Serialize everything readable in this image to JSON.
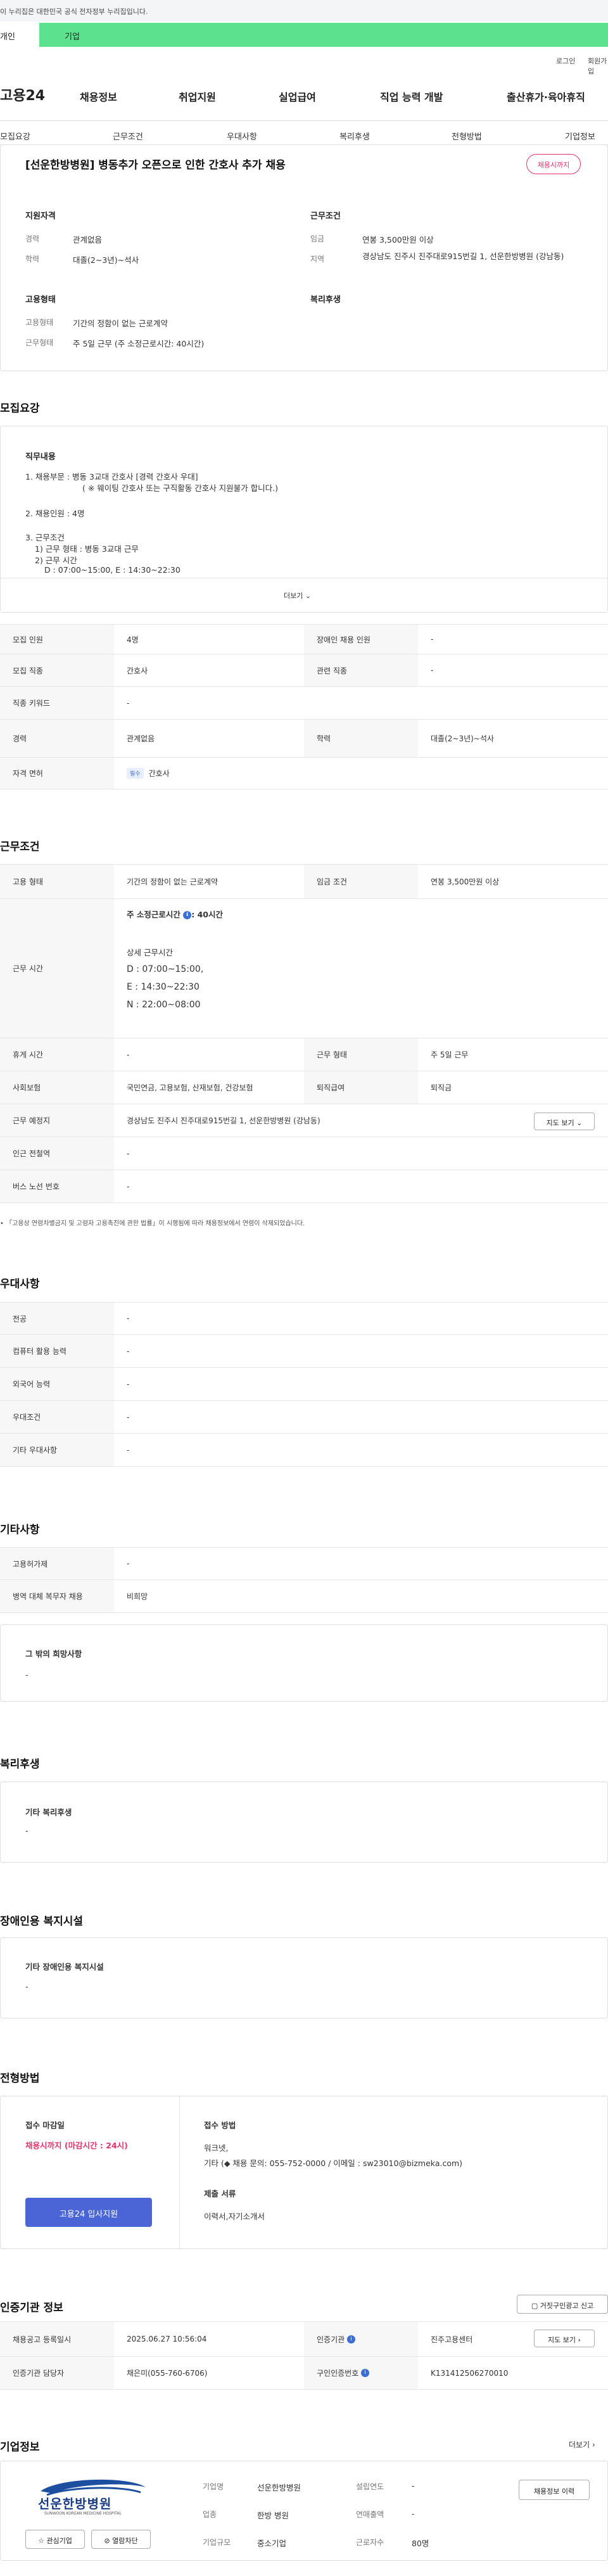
{
  "gov_banner": "이 누리집은 대한민국 공식 전자정부 누리집입니다.",
  "top_tabs": {
    "personal": "개인",
    "company": "기업"
  },
  "util": {
    "login": "로그인",
    "signup": "회원가입"
  },
  "logo": "고용24",
  "main_nav": [
    "채용정보",
    "취업지원",
    "실업급여",
    "직업 능력 개발",
    "출산휴가·육아휴직"
  ],
  "sub_nav": [
    "모집요강",
    "근무조건",
    "우대사항",
    "복리후생",
    "전형방법",
    "기업정보"
  ],
  "summary": {
    "title": "[선운한방병원] 병동추가 오픈으로 인한 간호사 추가 채용",
    "badge": "채용시까지",
    "qual_title": "지원자격",
    "career_lbl": "경력",
    "career": "관계없음",
    "edu_lbl": "학력",
    "edu": "대졸(2~3년)~석사",
    "cond_title": "근무조건",
    "wage_lbl": "임금",
    "wage": "연봉 3,500만원 이상",
    "area_lbl": "지역",
    "area": "경상남도 진주시 진주대로915번길 1, 선운한방병원 (강남동)",
    "emp_title": "고용형태",
    "emptype_lbl": "고용형태",
    "emptype": "기간의 정함이 없는 근로계약",
    "worktype_lbl": "근무형태",
    "worktype": "주 5일 근무 (주 소정근로시간: 40시간)",
    "welfare_title": "복리후생"
  },
  "recruit": {
    "section": "모집요강",
    "job_title": "직무내용",
    "lines": [
      "1. 채용부문 :  병동 3교대 간호사 [경력 간호사 우대]",
      "( ※ 웨이팅 간호사 또는 구직활동 간호사 지원불가 합니다.)",
      "2. 채용인원 :  4명",
      "3.  근무조건",
      "1) 근무 형태 :  병동 3교대 근무",
      "2) 근무 시간",
      "D : 07:00~15:00, E : 14:30~22:30"
    ],
    "more": "더보기",
    "rows": [
      {
        "l1": "모집 인원",
        "v1": "4명",
        "l2": "장애인 채용 인원",
        "v2": "-"
      },
      {
        "l1": "모집 직종",
        "v1": "간호사",
        "l2": "관련 직종",
        "v2": "-"
      },
      {
        "l1": "직종 키워드",
        "v1": "-"
      },
      {
        "l1": "경력",
        "v1": "관계없음",
        "l2": "학력",
        "v2": "대졸(2~3년)~석사"
      },
      {
        "l1": "자격 면허",
        "tag": "필수",
        "v1": "간호사"
      }
    ]
  },
  "conditions": {
    "section": "근무조건",
    "emptype_lbl": "고용 형태",
    "emptype": "기간의 정함이 없는 근로계약",
    "wage_lbl": "임금 조건",
    "wage": "연봉 3,500만원 이상",
    "hours_lbl": "근무 시간",
    "hours_title": "주 소정근로시간",
    "hours": ": 40시간",
    "detail_title": "상세 근무시간",
    "d": "D : 07:00~15:00,",
    "e": "E : 14:30~22:30",
    "n": "N : 22:00~08:00",
    "break_lbl": "휴게 시간",
    "break": "-",
    "form_lbl": "근무 형태",
    "form": "주 5일 근무",
    "ins_lbl": "사회보험",
    "ins": "국민연금, 고용보험, 산재보험, 건강보험",
    "ret_lbl": "퇴직급여",
    "ret": "퇴직금",
    "loc_lbl": "근무 예정지",
    "loc": "경상남도 진주시 진주대로915번길 1, 선운한방병원 (강남동)",
    "map_btn": "지도 보기",
    "station_lbl": "인근 전철역",
    "station": "-",
    "bus_lbl": "버스 노선 번호",
    "bus": "-",
    "note": "「고용상 연령차별금지 및 고령자 고용촉진에 관한 법률」이 시행됨에 따라 채용정보에서 연령이 삭제되었습니다."
  },
  "pref": {
    "section": "우대사항",
    "rows": [
      {
        "l": "전공",
        "v": "-"
      },
      {
        "l": "컴퓨터 활용 능력",
        "v": "-"
      },
      {
        "l": "외국어 능력",
        "v": "-"
      },
      {
        "l": "우대조건",
        "v": "-"
      },
      {
        "l": "기타 우대사항",
        "v": "-"
      }
    ]
  },
  "etc": {
    "section": "기타사항",
    "rows": [
      {
        "l": "고용허가제",
        "v": "-"
      },
      {
        "l": "병역 대체 복무자 채용",
        "v": "비희망"
      }
    ],
    "other_title": "그 밖의 희망사항",
    "other": "-"
  },
  "welfare": {
    "section": "복리후생",
    "title": "기타 복리후생",
    "val": "-"
  },
  "disability": {
    "section": "장애인용 복지시설",
    "title": "기타 장애인용 복지시설",
    "val": "-"
  },
  "process": {
    "section": "전형방법",
    "deadline_title": "접수 마감일",
    "deadline": "채용시까지 (마감시간 : 24시)",
    "apply_btn": "고용24 입사지원",
    "method_title": "접수 방법",
    "method1": "워크넷,",
    "method2": "기타 (◆ 채용 문의: 055-752-0000 / 이메일 : sw23010@bizmeka.com)",
    "docs_title": "제출 서류",
    "docs": "이력서,자기소개서"
  },
  "cert": {
    "section": "인증기관 정보",
    "report_btn": "거짓구인광고 신고",
    "reg_lbl": "채용공고 등록일시",
    "reg": "2025.06.27 10:56:04",
    "agency_lbl": "인증기관",
    "agency": "진주고용센터",
    "map_btn": "지도 보기",
    "manager_lbl": "인증기관 담당자",
    "manager": "채은미(055-760-6706)",
    "num_lbl": "구인인증번호",
    "num": "K131412506270010"
  },
  "company": {
    "section": "기업정보",
    "more": "더보기",
    "logo_text": "선운한방병원",
    "logo_sub": "SUNWOON KOREAN MEDICINE HOSPITAL",
    "fav_btn": "관심기업",
    "block_btn": "열람차단",
    "jobs_btn": "채용정보 이력",
    "name_lbl": "기업명",
    "name": "선운한방병원",
    "year_lbl": "설립연도",
    "year": "-",
    "ind_lbl": "업종",
    "ind": "한방 병원",
    "sales_lbl": "연매출액",
    "sales": "-",
    "size_lbl": "기업규모",
    "size": "중소기업",
    "emp_lbl": "근로자수",
    "emp": "80명"
  }
}
